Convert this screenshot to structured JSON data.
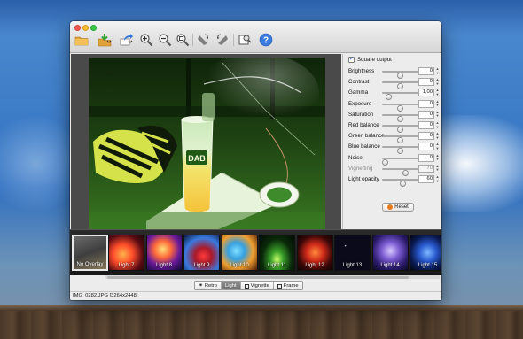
{
  "toolbar": {
    "items": [
      {
        "icon": "open-folder-icon"
      },
      {
        "icon": "import-icon"
      },
      {
        "icon": "share-icon"
      },
      {
        "icon": "zoom-in-icon"
      },
      {
        "icon": "zoom-out-icon"
      },
      {
        "icon": "zoom-fit-icon"
      },
      {
        "icon": "rotate-left-icon"
      },
      {
        "icon": "rotate-right-icon"
      },
      {
        "icon": "crop-icon"
      },
      {
        "icon": "help-icon"
      }
    ]
  },
  "panel": {
    "square_output": {
      "label": "Square output",
      "checked": true
    },
    "adjustments": [
      {
        "label": "Brightness",
        "value": "0",
        "level": 0.5,
        "enabled": true
      },
      {
        "label": "Contrast",
        "value": "0",
        "level": 0.5,
        "enabled": true
      },
      {
        "label": "Gamma",
        "value": "1,00",
        "level": 0.12,
        "enabled": true
      },
      {
        "label": "Exposure",
        "value": "0",
        "level": 0.5,
        "enabled": true
      },
      {
        "label": "Saturation",
        "value": "0",
        "level": 0.5,
        "enabled": true
      },
      {
        "label": "Red balance",
        "value": "0",
        "level": 0.5,
        "enabled": true
      },
      {
        "label": "Green balance",
        "value": "0",
        "level": 0.5,
        "enabled": true
      },
      {
        "label": "Blue balance",
        "value": "0",
        "level": 0.5,
        "enabled": true
      },
      {
        "label": "Noise",
        "value": "0",
        "level": 0.0,
        "enabled": true
      },
      {
        "label": "Vignetting",
        "value": "70",
        "level": 0.7,
        "enabled": false
      },
      {
        "label": "Light opacity",
        "value": "60",
        "level": 0.6,
        "enabled": true
      }
    ],
    "reset_label": "Reset"
  },
  "filmstrip": {
    "items": [
      {
        "label": "No Overlay",
        "selected": true
      },
      {
        "label": "Light 7"
      },
      {
        "label": "Light 8"
      },
      {
        "label": "Light 9"
      },
      {
        "label": "Light 10"
      },
      {
        "label": "Light 11"
      },
      {
        "label": "Light 12"
      },
      {
        "label": "Light 13"
      },
      {
        "label": "Light 14"
      },
      {
        "label": "Light 15"
      }
    ]
  },
  "tabs": [
    {
      "label": "Retro",
      "active": false
    },
    {
      "label": "Light",
      "active": true
    },
    {
      "label": "Vignette",
      "active": false
    },
    {
      "label": "Frame",
      "active": false
    }
  ],
  "photo": {
    "caption_mug": "DAB"
  },
  "status": {
    "text": "IMG_0282.JPG [3264x2448]"
  },
  "colors": {
    "accent": "#1a63d6",
    "reset": "#e67a1e"
  }
}
